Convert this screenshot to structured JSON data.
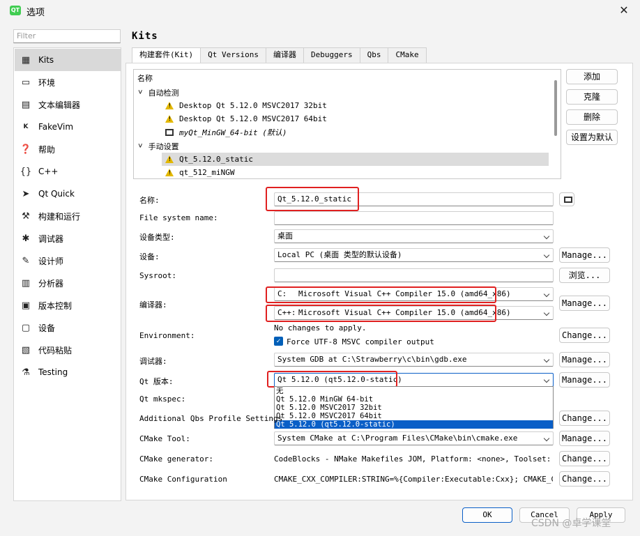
{
  "window": {
    "title": "选项",
    "app_icon": "QT"
  },
  "filter": {
    "placeholder": "Filter"
  },
  "sidebar": {
    "items": [
      {
        "label": "Kits",
        "icon": "kits-icon"
      },
      {
        "label": "环境",
        "icon": "monitor-icon"
      },
      {
        "label": "文本编辑器",
        "icon": "text-editor-icon"
      },
      {
        "label": "FakeVim",
        "icon": "fakevim-icon"
      },
      {
        "label": "帮助",
        "icon": "help-icon"
      },
      {
        "label": "C++",
        "icon": "braces-icon"
      },
      {
        "label": "Qt Quick",
        "icon": "send-icon"
      },
      {
        "label": "构建和运行",
        "icon": "hammer-icon"
      },
      {
        "label": "调试器",
        "icon": "bug-icon"
      },
      {
        "label": "设计师",
        "icon": "pencil-icon"
      },
      {
        "label": "分析器",
        "icon": "analyzer-icon"
      },
      {
        "label": "版本控制",
        "icon": "version-control-icon"
      },
      {
        "label": "设备",
        "icon": "device-icon"
      },
      {
        "label": "代码粘贴",
        "icon": "clipboard-icon"
      },
      {
        "label": "Testing",
        "icon": "flask-icon"
      }
    ]
  },
  "heading": "Kits",
  "tabs": [
    "构建套件(Kit)",
    "Qt Versions",
    "编译器",
    "Debuggers",
    "Qbs",
    "CMake"
  ],
  "tree": {
    "header": "名称",
    "auto_group": "自动检测",
    "auto_items": [
      "Desktop Qt 5.12.0 MSVC2017 32bit",
      "Desktop Qt 5.12.0 MSVC2017 64bit",
      "myQt_MinGW_64-bit (默认)"
    ],
    "manual_group": "手动设置",
    "manual_items": [
      "Qt_5.12.0_static",
      "qt_512_miNGW"
    ]
  },
  "side_buttons": [
    "添加",
    "克隆",
    "删除",
    "设置为默认"
  ],
  "form": {
    "name_label": "名称:",
    "name_value": "Qt_5.12.0_static",
    "fsname_label": "File system name:",
    "devtype_label": "设备类型:",
    "devtype_value": "桌面",
    "device_label": "设备:",
    "device_value": "Local PC (桌面 类型的默认设备)",
    "sysroot_label": "Sysroot:",
    "browse": "浏览...",
    "compiler_label": "编译器:",
    "c_prefix": "C:",
    "c_value": "Microsoft Visual C++ Compiler 15.0 (amd64_x86)",
    "cpp_prefix": "C++:",
    "cpp_value": "Microsoft Visual C++ Compiler 15.0 (amd64_x86)",
    "env_label": "Environment:",
    "env_text": "No changes to apply.",
    "utf8_label": "Force UTF-8 MSVC compiler output",
    "debugger_label": "调试器:",
    "debugger_value": "System GDB at C:\\Strawberry\\c\\bin\\gdb.exe",
    "qtver_label": "Qt 版本:",
    "qtver_value": "Qt 5.12.0 (qt5.12.0-static)",
    "mkspec_label": "Qt mkspec:",
    "qbs_label": "Additional Qbs Profile Settings",
    "cmake_tool_label": "CMake Tool:",
    "cmake_tool_value": "System CMake at C:\\Program Files\\CMake\\bin\\cmake.exe",
    "cmake_gen_label": "CMake generator:",
    "cmake_gen_value": "CodeBlocks - NMake Makefiles JOM, Platform: <none>, Toolset: <none>",
    "cmake_conf_label": "CMake Configuration",
    "cmake_conf_value": "CMAKE_CXX_COMPILER:STRING=%{Compiler:Executable:Cxx}; CMAKE_C_CO…",
    "manage": "Manage...",
    "change": "Change..."
  },
  "dropdown": {
    "options": [
      "无",
      "Qt 5.12.0 MinGW 64-bit",
      "Qt 5.12.0 MSVC2017 32bit",
      "Qt 5.12.0 MSVC2017 64bit",
      "Qt 5.12.0 (qt5.12.0-static)"
    ],
    "selected": "Qt 5.12.0 (qt5.12.0-static)"
  },
  "footer": {
    "ok": "OK",
    "cancel": "Cancel",
    "apply": "Apply"
  },
  "watermark": "CSDN @卓学课堂",
  "colors": {
    "highlight": "#e02020",
    "selection": "#0a5fc7",
    "warning": "#e3b800"
  }
}
